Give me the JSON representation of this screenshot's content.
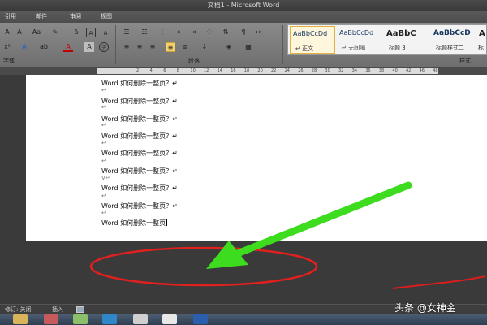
{
  "window": {
    "title": "文档1 - Microsoft Word"
  },
  "ribbon": {
    "tabs": [
      "引用",
      "邮件",
      "审阅",
      "视图"
    ],
    "groups": {
      "font": "字体",
      "paragraph": "段落",
      "styles": "样式"
    },
    "styles": [
      {
        "sample": "AaBbCcDd",
        "name": "↵ 正文",
        "selected": true
      },
      {
        "sample": "AaBbCcDd",
        "name": "↵ 无间隔",
        "selected": false
      },
      {
        "sample": "AaBbC",
        "name": "标题 3",
        "selected": false
      },
      {
        "sample": "AaBbCcD",
        "name": "标题样式二",
        "selected": false
      },
      {
        "sample": "A",
        "name": "标",
        "selected": false
      }
    ]
  },
  "ruler": {
    "ticks": [
      "2",
      "4",
      "6",
      "8",
      "10",
      "12",
      "14",
      "16",
      "18",
      "20",
      "22",
      "24",
      "26",
      "28",
      "30",
      "32",
      "34",
      "36",
      "38",
      "40",
      "42",
      "46",
      "48"
    ]
  },
  "document": {
    "paragraph_mark": "↵",
    "lines": [
      "Word 如何删除一整页？↵",
      "Word 如何删除一整页？↵",
      "Word 如何删除一整页？↵",
      "Word 如何删除一整页？↵",
      "Word 如何删除一整页？↵",
      "Word 如何删除一整页？↵",
      "Word 如何删除一整页？↵",
      "Word 如何删除一整页？↵",
      "Word 如何删除一整页"
    ],
    "stray_mark": "V↵"
  },
  "statusbar": {
    "track_changes": "修订: 关闭",
    "insert_mode": "插入"
  },
  "watermark": "头条 @女神金",
  "colors": {
    "arrow": "#3ddc1f",
    "annotation": "#e0201f",
    "style_selected": "#e3b13d"
  }
}
